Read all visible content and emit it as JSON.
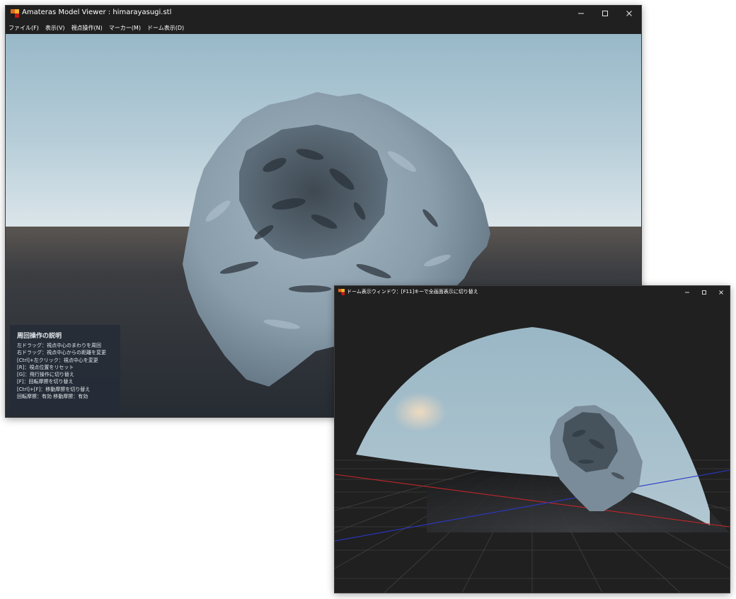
{
  "main_window": {
    "title": "Amateras Model Viewer : himarayasugi.stl",
    "menu": [
      "ファイル(F)",
      "表示(V)",
      "視点操作(N)",
      "マーカー(M)",
      "ドーム表示(D)"
    ],
    "help": {
      "title": "周回操作の説明",
      "lines": [
        "左ドラッグ：視点中心のまわりを周回",
        "右ドラッグ：視点中心からの距離を変更",
        "[Ctrl]+左クリック：視点中心を変更",
        "[R]：視点位置をリセット",
        "[G]：飛行操作に切り替え",
        "[F]：回転摩擦を切り替え",
        "[Ctrl]+[F]：移動摩擦を切り替え",
        "回転摩擦：有効 移動摩擦：有効"
      ]
    }
  },
  "dome_window": {
    "title": "ドーム表示ウィンドウ：[F11]キーで全画面表示に切り替え"
  },
  "icons": {
    "app": "amateras-app-icon",
    "minimize": "minimize-icon",
    "maximize": "maximize-icon",
    "close": "close-icon"
  },
  "colors": {
    "titlebar": "#202020",
    "sky_top": "#98b8c8",
    "sky_horizon": "#dbe5ea",
    "ground": "#2c3138",
    "model": "#8b9fae",
    "axis_x": "#c0262b",
    "axis_z": "#2a38c8"
  }
}
